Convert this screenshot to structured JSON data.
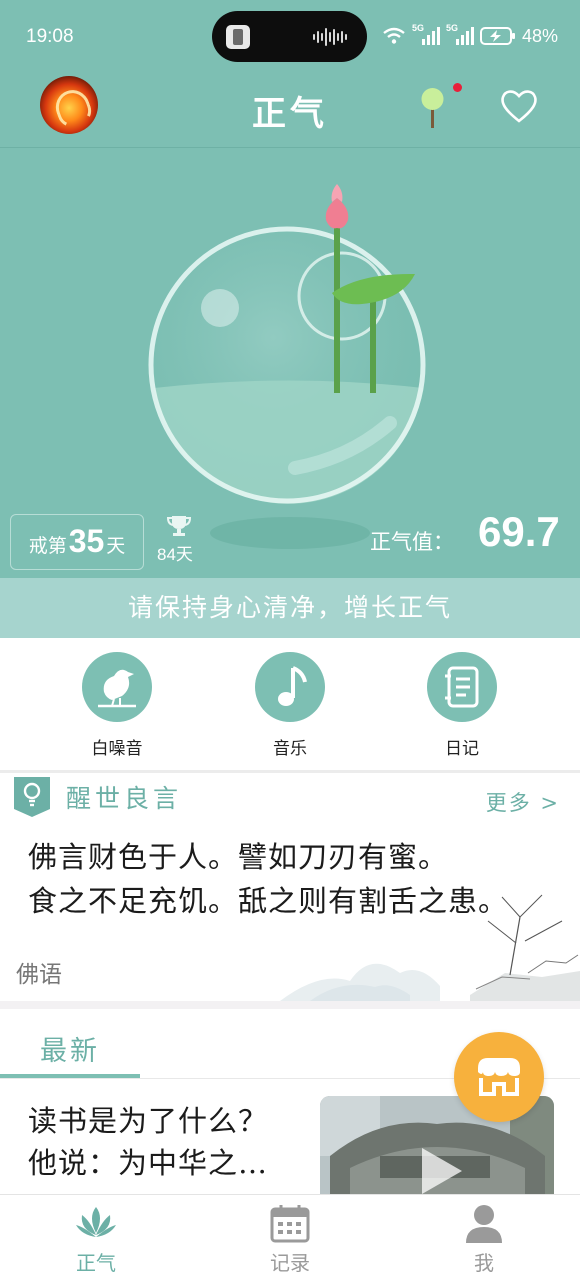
{
  "status_bar": {
    "time": "19:08",
    "network_5g_1": "5G",
    "network_5g_2": "5G",
    "battery_percent": "48%"
  },
  "header": {
    "title": "正气",
    "icons": [
      "avatar",
      "tree-icon",
      "heart-icon"
    ],
    "tree_notification": true
  },
  "stats": {
    "days_prefix": "戒第",
    "days_count": "35",
    "days_suffix": "天",
    "best_days": "84天",
    "zhengqi_label": "正气值：",
    "zhengqi_value": "69.7"
  },
  "slogan": "请保持身心清净，增长正气",
  "shortcuts": [
    {
      "label": "白噪音",
      "icon": "bird-icon"
    },
    {
      "label": "音乐",
      "icon": "music-note-icon"
    },
    {
      "label": "日记",
      "icon": "notebook-icon"
    }
  ],
  "quote": {
    "section_title": "醒世良言",
    "more_label": "更多 >",
    "line1": "佛言财色于人。譬如刀刃有蜜。",
    "line2": "食之不足充饥。舐之则有割舌之患。",
    "source": "佛语"
  },
  "latest": {
    "tab_label": "最新",
    "article_title_line1": "读书是为了什么？",
    "article_title_line2": "他说：为中华之…"
  },
  "bottom_nav": [
    {
      "label": "正气",
      "icon": "lotus-icon",
      "active": true
    },
    {
      "label": "记录",
      "icon": "calendar-icon",
      "active": false
    },
    {
      "label": "我",
      "icon": "person-icon",
      "active": false
    }
  ],
  "colors": {
    "primary_teal": "#7dbfb3",
    "slogan_bar": "#a6d4ce",
    "accent_text": "#6cb0a6",
    "fab_orange": "#f7b13d",
    "notification_red": "#e8203a"
  }
}
